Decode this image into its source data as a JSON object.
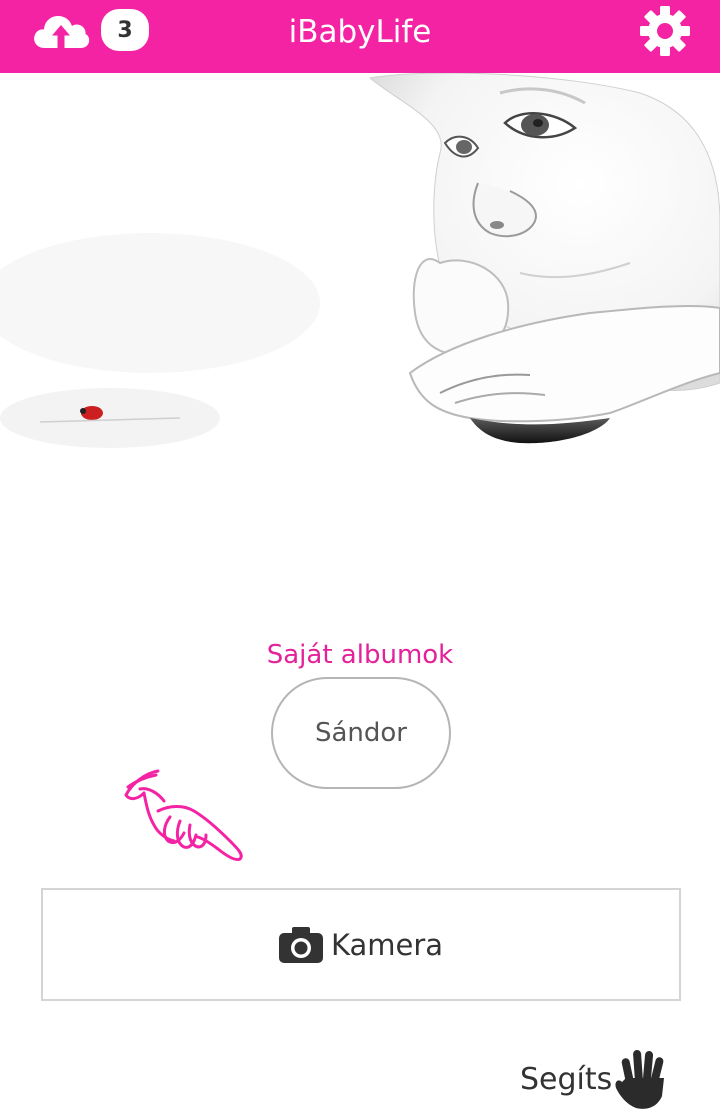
{
  "header": {
    "title": "iBabyLife",
    "upload_icon": "cloud-upload-icon",
    "pending_count": "3",
    "settings_icon": "gear-icon"
  },
  "hero": {
    "image": "baby-portrait-with-ladybug"
  },
  "albums": {
    "heading": "Saját albumok",
    "items": [
      {
        "label": "Sándor"
      }
    ]
  },
  "hint": {
    "icon": "pointing-hand-icon"
  },
  "camera": {
    "icon": "camera-icon",
    "label": "Kamera"
  },
  "help": {
    "label": "Segíts",
    "icon": "hand-icon"
  },
  "colors": {
    "accent": "#f423a4",
    "heading": "#e3219b",
    "text": "#333333"
  }
}
